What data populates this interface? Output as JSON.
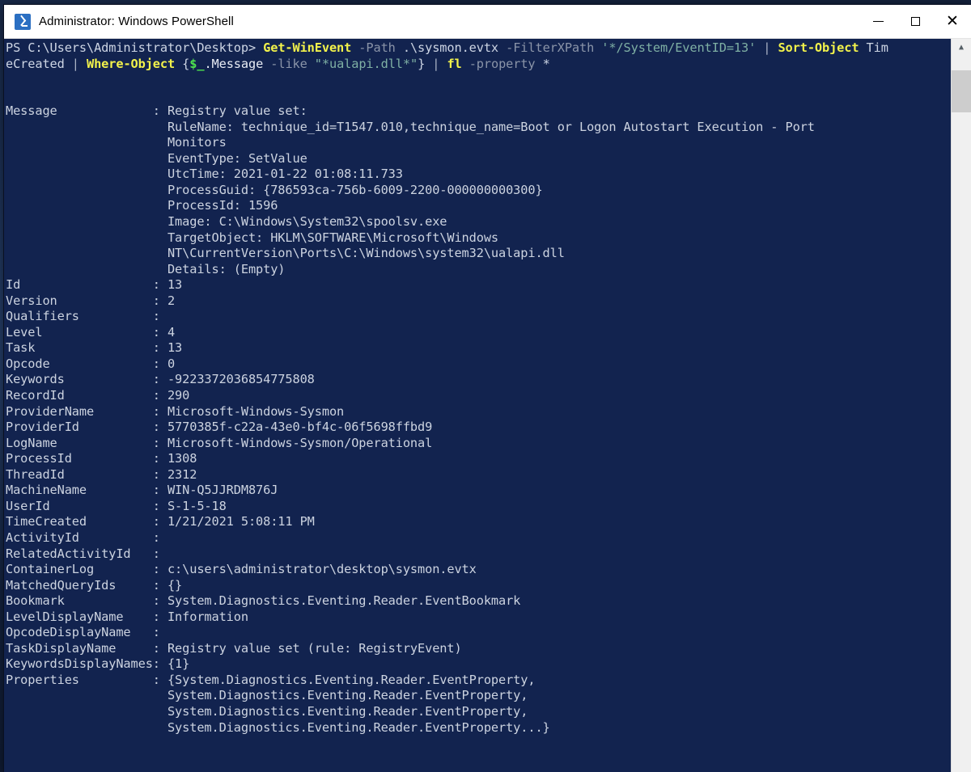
{
  "window": {
    "title": "Administrator: Windows PowerShell",
    "icon": "powershell-icon",
    "controls": {
      "minimize": "—",
      "maximize": "☐",
      "close": "✕"
    },
    "colors": {
      "console_background": "#12234F",
      "titlebar_background": "#FFFFFF",
      "text": "#CCD3E0",
      "cmdlet": "#F2F24B",
      "parameter": "#8A94A8",
      "string": "#7FB0A4",
      "variable": "#4EE24E",
      "scrollbar_track": "#F0F0F0",
      "scrollbar_thumb": "#CDCDCD"
    }
  },
  "scrollbar": {
    "up_arrow": "⌃",
    "down_arrow": "⌄",
    "thumb_position_percent": 2
  },
  "console": {
    "prompt": "PS C:\\Users\\Administrator\\Desktop> ",
    "command_tokens_line1": [
      {
        "text": "PS C:\\Users\\Administrator\\Desktop> ",
        "kind": "default"
      },
      {
        "text": "Get-WinEvent",
        "kind": "cmdlet"
      },
      {
        "text": " -Path",
        "kind": "param"
      },
      {
        "text": " .\\sysmon.evtx",
        "kind": "default"
      },
      {
        "text": " -FilterXPath",
        "kind": "param"
      },
      {
        "text": " '*/System/EventID=13'",
        "kind": "string"
      },
      {
        "text": " | ",
        "kind": "pipe"
      },
      {
        "text": "Sort-Object",
        "kind": "cmdlet"
      },
      {
        "text": " Tim",
        "kind": "default"
      }
    ],
    "command_tokens_line2": [
      {
        "text": "eCreated",
        "kind": "default"
      },
      {
        "text": " | ",
        "kind": "pipe"
      },
      {
        "text": "Where-Object",
        "kind": "cmdlet"
      },
      {
        "text": " {",
        "kind": "default"
      },
      {
        "text": "$_",
        "kind": "var"
      },
      {
        "text": ".Message",
        "kind": "white"
      },
      {
        "text": " -like",
        "kind": "param"
      },
      {
        "text": " \"*ualapi.dll*\"",
        "kind": "string"
      },
      {
        "text": "} ",
        "kind": "default"
      },
      {
        "text": "| ",
        "kind": "pipe"
      },
      {
        "text": "fl",
        "kind": "cmdlet"
      },
      {
        "text": " -property",
        "kind": "param"
      },
      {
        "text": " *",
        "kind": "default"
      }
    ],
    "blank_after_command": 2,
    "message_label": "Message",
    "message_lines": [
      "Registry value set:",
      "RuleName: technique_id=T1547.010,technique_name=Boot or Logon Autostart Execution - Port",
      "Monitors",
      "EventType: SetValue",
      "UtcTime: 2021-01-22 01:08:11.733",
      "ProcessGuid: {786593ca-756b-6009-2200-000000000300}",
      "ProcessId: 1596",
      "Image: C:\\Windows\\System32\\spoolsv.exe",
      "TargetObject: HKLM\\SOFTWARE\\Microsoft\\Windows",
      "NT\\CurrentVersion\\Ports\\C:\\Windows\\system32\\ualapi.dll",
      "Details: (Empty)"
    ],
    "properties": [
      {
        "name": "Id",
        "value": "13"
      },
      {
        "name": "Version",
        "value": "2"
      },
      {
        "name": "Qualifiers",
        "value": ""
      },
      {
        "name": "Level",
        "value": "4"
      },
      {
        "name": "Task",
        "value": "13"
      },
      {
        "name": "Opcode",
        "value": "0"
      },
      {
        "name": "Keywords",
        "value": "-9223372036854775808"
      },
      {
        "name": "RecordId",
        "value": "290"
      },
      {
        "name": "ProviderName",
        "value": "Microsoft-Windows-Sysmon"
      },
      {
        "name": "ProviderId",
        "value": "5770385f-c22a-43e0-bf4c-06f5698ffbd9"
      },
      {
        "name": "LogName",
        "value": "Microsoft-Windows-Sysmon/Operational"
      },
      {
        "name": "ProcessId",
        "value": "1308"
      },
      {
        "name": "ThreadId",
        "value": "2312"
      },
      {
        "name": "MachineName",
        "value": "WIN-Q5JJRDM876J"
      },
      {
        "name": "UserId",
        "value": "S-1-5-18"
      },
      {
        "name": "TimeCreated",
        "value": "1/21/2021 5:08:11 PM"
      },
      {
        "name": "ActivityId",
        "value": ""
      },
      {
        "name": "RelatedActivityId",
        "value": ""
      },
      {
        "name": "ContainerLog",
        "value": "c:\\users\\administrator\\desktop\\sysmon.evtx"
      },
      {
        "name": "MatchedQueryIds",
        "value": "{}"
      },
      {
        "name": "Bookmark",
        "value": "System.Diagnostics.Eventing.Reader.EventBookmark"
      },
      {
        "name": "LevelDisplayName",
        "value": "Information"
      },
      {
        "name": "OpcodeDisplayName",
        "value": ""
      },
      {
        "name": "TaskDisplayName",
        "value": "Registry value set (rule: RegistryEvent)"
      },
      {
        "name": "KeywordsDisplayNames",
        "value": "{1}"
      },
      {
        "name": "Properties",
        "value": "{System.Diagnostics.Eventing.Reader.EventProperty,"
      }
    ],
    "properties_continuation": [
      "System.Diagnostics.Eventing.Reader.EventProperty,",
      "System.Diagnostics.Eventing.Reader.EventProperty,",
      "System.Diagnostics.Eventing.Reader.EventProperty...}"
    ],
    "label_column_width": 20,
    "value_separator": ": "
  }
}
